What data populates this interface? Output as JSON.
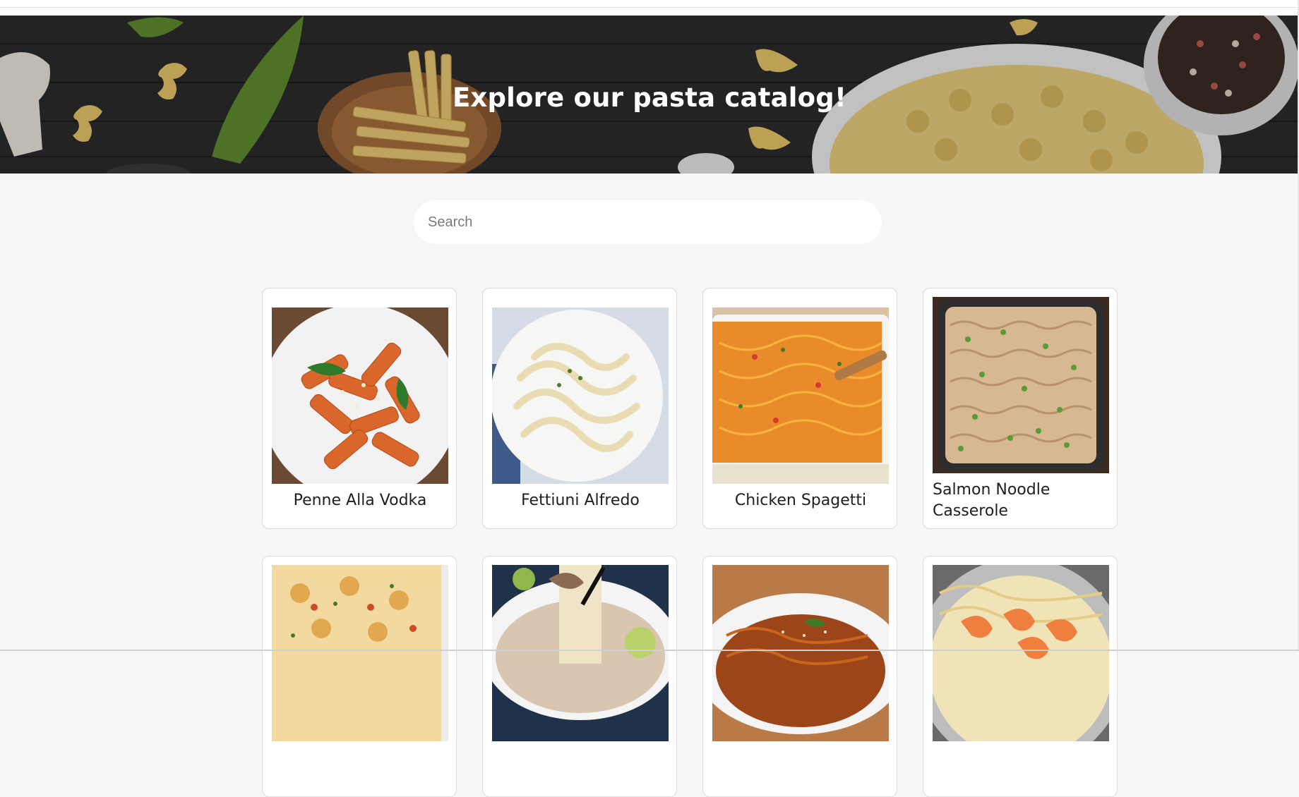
{
  "hero": {
    "title": "Explore our pasta catalog!"
  },
  "search": {
    "placeholder": "Search",
    "value": ""
  },
  "recipes": [
    {
      "name": "Penne Alla Vodka",
      "image": "penne-alla-vodka-photo"
    },
    {
      "name": "Fettiuni Alfredo",
      "image": "fettuccine-alfredo-photo"
    },
    {
      "name": "Chicken Spagetti",
      "image": "chicken-spaghetti-photo"
    },
    {
      "name": "Salmon Noodle Casserole",
      "image": "salmon-noodle-casserole-photo"
    },
    {
      "name": "",
      "image": "baked-pasta-casserole-photo"
    },
    {
      "name": "",
      "image": "noodle-soup-photo"
    },
    {
      "name": "",
      "image": "sesame-noodles-photo"
    },
    {
      "name": "",
      "image": "shrimp-pasta-photo"
    }
  ],
  "colors": {
    "page_background": "#f7f5f5",
    "card_background": "#ffffff",
    "hero_text": "#ffffff"
  }
}
